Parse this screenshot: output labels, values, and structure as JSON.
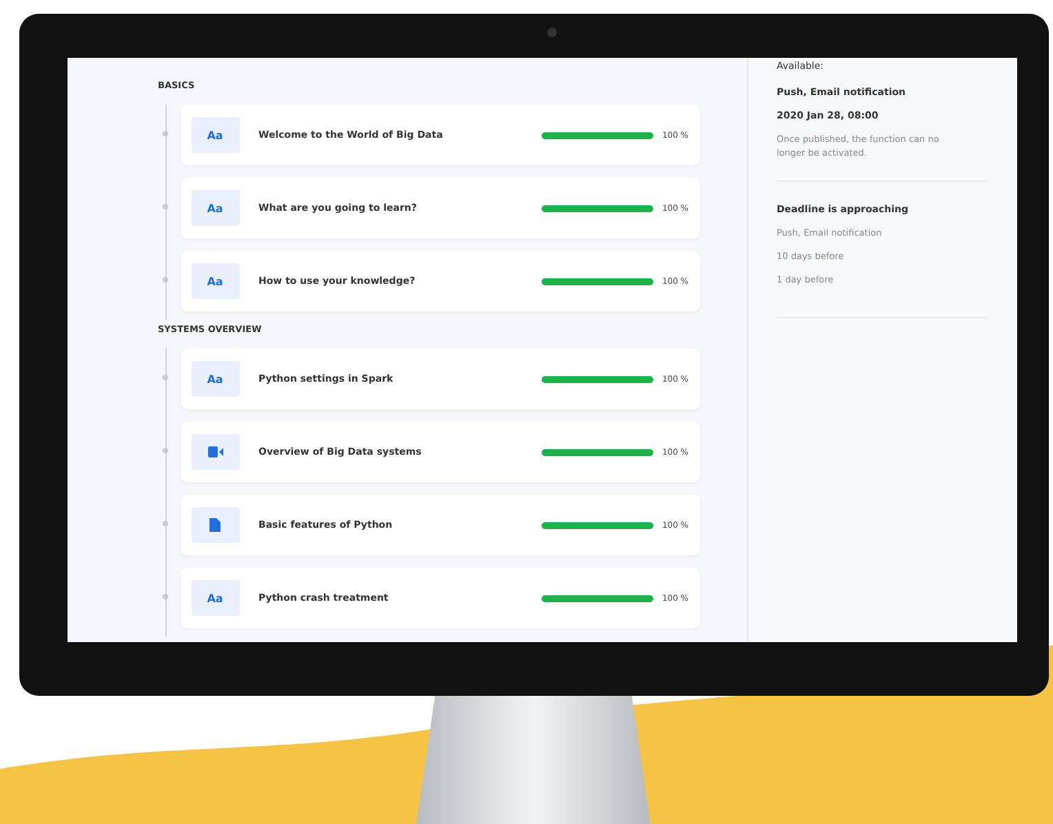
{
  "sections": [
    {
      "title": "BASICS",
      "lessons": [
        {
          "kind": "text",
          "icon_label": "Aa",
          "title": "Welcome to the World of Big Data",
          "level": 1,
          "reading": "100 %"
        },
        {
          "kind": "text",
          "icon_label": "Aa",
          "title": "What are you going to learn?",
          "level": 1,
          "reading": "100 %"
        },
        {
          "kind": "text",
          "icon_label": "Aa",
          "title": "How to use your knowledge?",
          "level": 1,
          "reading": "100 %"
        }
      ]
    },
    {
      "title": "SYSTEMS OVERVIEW",
      "lessons": [
        {
          "kind": "text",
          "icon_label": "Aa",
          "title": "Python settings in Spark",
          "level": 1,
          "reading": "100 %"
        },
        {
          "kind": "video",
          "title": "Overview of Big Data systems",
          "level": 1,
          "reading": "100 %"
        },
        {
          "kind": "document",
          "title": "Basic features of Python",
          "level": 1,
          "reading": "100 %"
        },
        {
          "kind": "text",
          "icon_label": "Aa",
          "title": "Python crash treatment",
          "level": 1,
          "reading": "100 %"
        }
      ]
    }
  ],
  "side_panel": {
    "available_label": "Available:",
    "channels": "Push, Email notification",
    "date": "2020 Jan 28, 08:00",
    "note": "Once published, the function can no longer be activated.",
    "deadline_title": "Deadline is approaching",
    "deadline_items": [
      "Push, Email notification",
      "10 days before",
      "1 day before"
    ]
  }
}
